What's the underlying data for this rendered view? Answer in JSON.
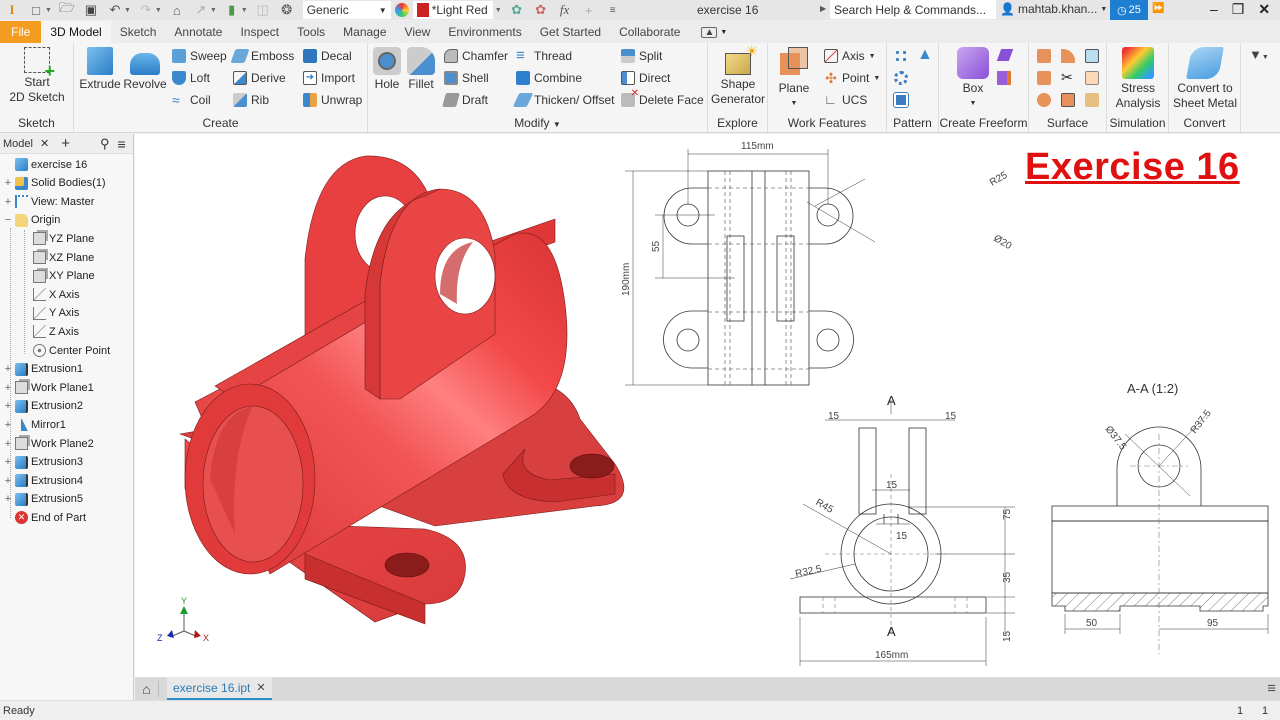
{
  "app": {
    "document_title": "exercise 16",
    "search_placeholder": "Search Help & Commands...",
    "user_name": "mahtab.khan...",
    "clock_count": "25",
    "material": "Generic",
    "appearance": "*Light Red"
  },
  "tabs": [
    "File",
    "3D Model",
    "Sketch",
    "Annotate",
    "Inspect",
    "Tools",
    "Manage",
    "View",
    "Environments",
    "Get Started",
    "Collaborate"
  ],
  "ribbon": {
    "sketch": {
      "label": "Sketch",
      "start_line1": "Start",
      "start_line2": "2D Sketch"
    },
    "create": {
      "label": "Create",
      "extrude": "Extrude",
      "revolve": "Revolve",
      "sweep": "Sweep",
      "loft": "Loft",
      "coil": "Coil",
      "emboss": "Emboss",
      "derive": "Derive",
      "rib": "Rib",
      "decal": "Decal",
      "import": "Import",
      "unwrap": "Unwrap"
    },
    "modify": {
      "label": "Modify",
      "hole": "Hole",
      "fillet": "Fillet",
      "chamfer": "Chamfer",
      "shell": "Shell",
      "draft": "Draft",
      "thread": "Thread",
      "combine": "Combine",
      "thicken": "Thicken/ Offset",
      "split": "Split",
      "direct": "Direct",
      "delete_face": "Delete Face"
    },
    "explore": {
      "label": "Explore",
      "line1": "Shape",
      "line2": "Generator"
    },
    "work_features": {
      "label": "Work Features",
      "plane": "Plane",
      "axis": "Axis",
      "point": "Point",
      "ucs": "UCS"
    },
    "pattern": {
      "label": "Pattern"
    },
    "freeform": {
      "label": "Create Freeform",
      "box": "Box"
    },
    "surface": {
      "label": "Surface"
    },
    "simulation": {
      "label": "Simulation",
      "line1": "Stress",
      "line2": "Analysis"
    },
    "convert": {
      "label": "Convert",
      "line1": "Convert to",
      "line2": "Sheet Metal"
    }
  },
  "browser": {
    "tab_label": "Model",
    "items": [
      {
        "label": "exercise 16"
      },
      {
        "label": "Solid Bodies(1)"
      },
      {
        "label": "View: Master"
      },
      {
        "label": "Origin"
      },
      {
        "label": "YZ Plane"
      },
      {
        "label": "XZ Plane"
      },
      {
        "label": "XY Plane"
      },
      {
        "label": "X Axis"
      },
      {
        "label": "Y Axis"
      },
      {
        "label": "Z Axis"
      },
      {
        "label": "Center Point"
      },
      {
        "label": "Extrusion1"
      },
      {
        "label": "Work Plane1"
      },
      {
        "label": "Extrusion2"
      },
      {
        "label": "Mirror1"
      },
      {
        "label": "Work Plane2"
      },
      {
        "label": "Extrusion3"
      },
      {
        "label": "Extrusion4"
      },
      {
        "label": "Extrusion5"
      },
      {
        "label": "End of Part"
      }
    ]
  },
  "canvas": {
    "title": "Exercise 16",
    "triad": {
      "x": "X",
      "y": "Y",
      "z": "Z"
    },
    "drawing": {
      "top_view": {
        "width": "115mm",
        "height": "190mm",
        "spacing": "55",
        "radius": "R25",
        "hole_dia": "Ø20"
      },
      "front_view": {
        "section_mark": "A",
        "slot_left": "15",
        "slot_right": "15",
        "slot_gap": "15",
        "key_width": "15",
        "outer_radius": "R45",
        "inner_radius": "R32.5",
        "height_upper": "75",
        "height_mid": "35",
        "height_base": "15",
        "base_width": "165mm"
      },
      "section_view": {
        "title": "A-A (1:2)",
        "hole_dia": "Ø37.5",
        "radius": "R37.5",
        "dim_left": "50",
        "dim_right": "95"
      }
    }
  },
  "doc_tabs": [
    {
      "label": "exercise 16.ipt"
    }
  ],
  "status": {
    "text": "Ready",
    "count1": "1",
    "count2": "1"
  }
}
